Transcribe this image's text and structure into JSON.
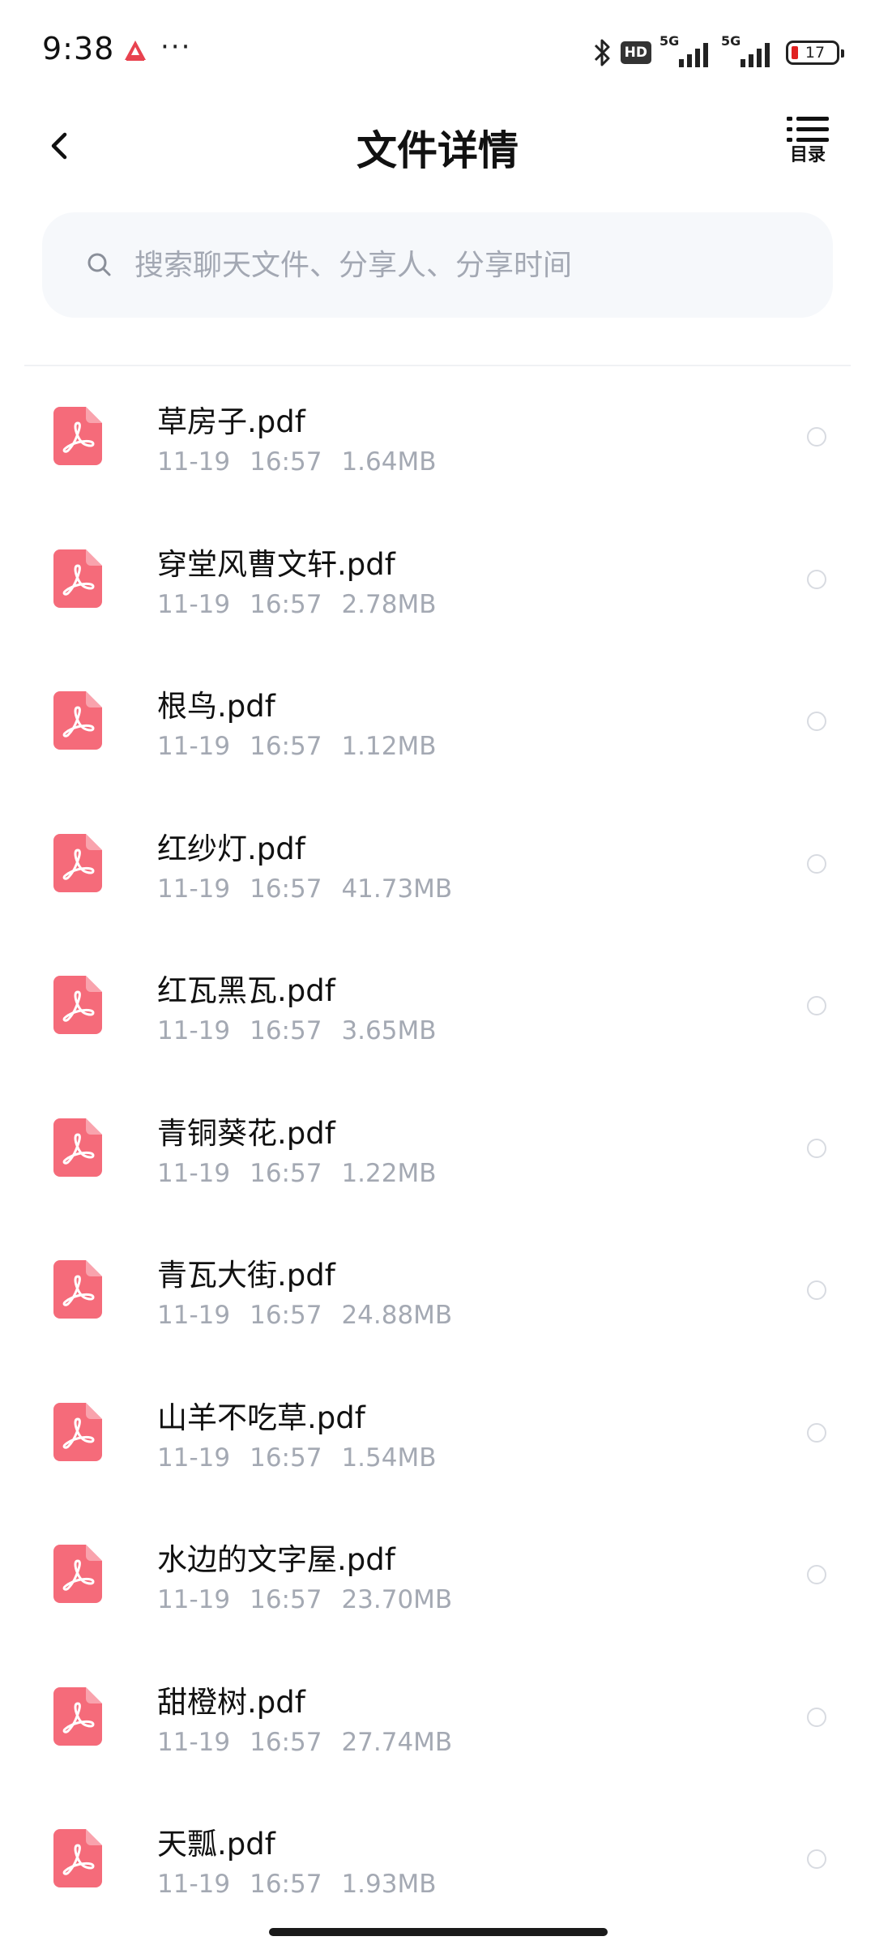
{
  "status_bar": {
    "time": "9:38",
    "more": "···",
    "hd_label": "HD",
    "sim1_label": "5G",
    "sim2_label": "5G",
    "battery_level": "17"
  },
  "header": {
    "title": "文件详情",
    "catalog_label": "目录"
  },
  "search": {
    "placeholder": "搜索聊天文件、分享人、分享时间",
    "value": ""
  },
  "files": [
    {
      "name": "草房子.pdf",
      "date": "11-19",
      "time": "16:57",
      "size": "1.64MB"
    },
    {
      "name": "穿堂风曹文轩.pdf",
      "date": "11-19",
      "time": "16:57",
      "size": "2.78MB"
    },
    {
      "name": "根鸟.pdf",
      "date": "11-19",
      "time": "16:57",
      "size": "1.12MB"
    },
    {
      "name": "红纱灯.pdf",
      "date": "11-19",
      "time": "16:57",
      "size": "41.73MB"
    },
    {
      "name": "红瓦黑瓦.pdf",
      "date": "11-19",
      "time": "16:57",
      "size": "3.65MB"
    },
    {
      "name": "青铜葵花.pdf",
      "date": "11-19",
      "time": "16:57",
      "size": "1.22MB"
    },
    {
      "name": "青瓦大街.pdf",
      "date": "11-19",
      "time": "16:57",
      "size": "24.88MB"
    },
    {
      "name": "山羊不吃草.pdf",
      "date": "11-19",
      "time": "16:57",
      "size": "1.54MB"
    },
    {
      "name": "水边的文字屋.pdf",
      "date": "11-19",
      "time": "16:57",
      "size": "23.70MB"
    },
    {
      "name": "甜橙树.pdf",
      "date": "11-19",
      "time": "16:57",
      "size": "27.74MB"
    },
    {
      "name": "天瓢.pdf",
      "date": "11-19",
      "time": "16:57",
      "size": "1.93MB"
    }
  ],
  "colors": {
    "pdf_icon": "#f56b7a",
    "meta_text": "#a4a9b3",
    "search_bg": "#f6f8fb"
  }
}
